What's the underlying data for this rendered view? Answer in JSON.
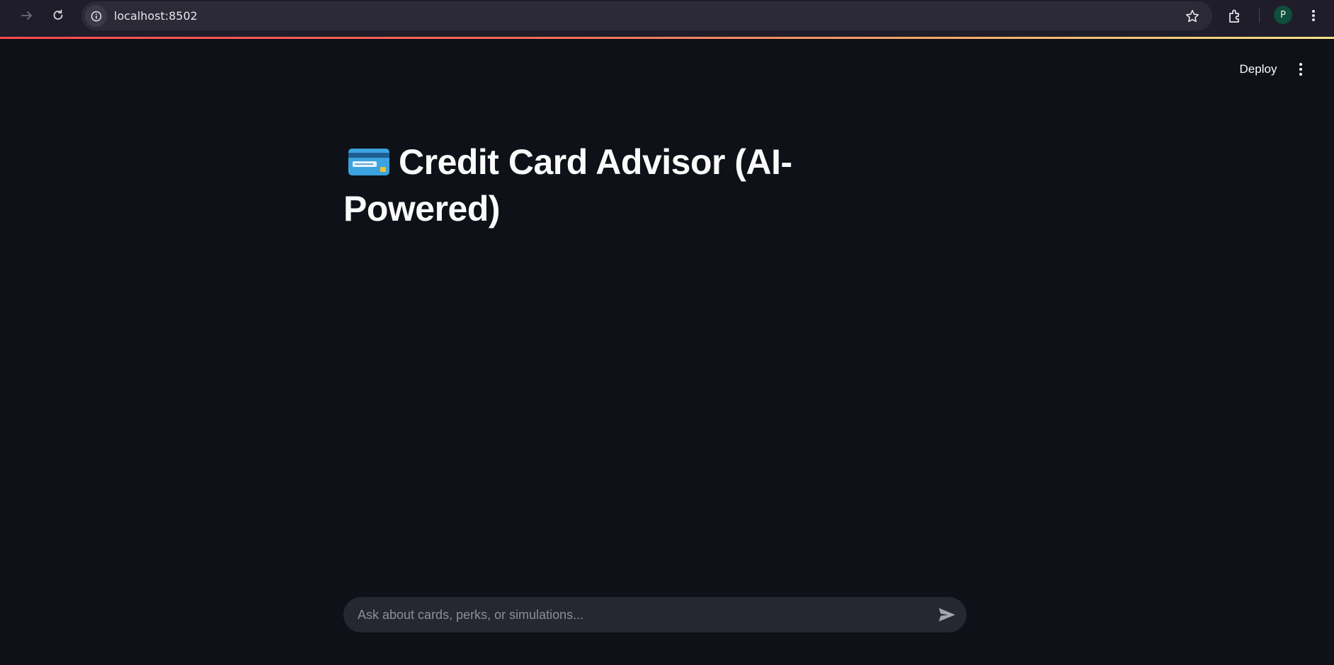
{
  "browser": {
    "url": "localhost:8502",
    "profile_initial": "P"
  },
  "header": {
    "deploy_label": "Deploy"
  },
  "main": {
    "title": "Credit Card Advisor (AI-Powered)",
    "title_icon": "credit-card-icon"
  },
  "chat": {
    "placeholder": "Ask about cards, perks, or simulations...",
    "value": ""
  },
  "colors": {
    "background": "#0e1117",
    "text": "#fafafa",
    "input_bg": "#262730",
    "accent": "#ff4b4b"
  }
}
